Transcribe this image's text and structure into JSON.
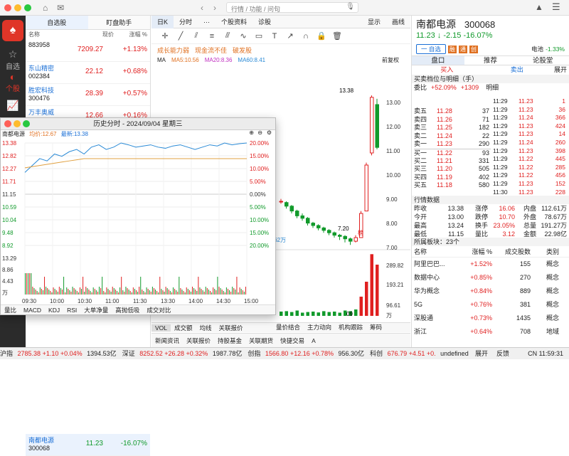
{
  "search_placeholder": "行情 / 功能 / 问句",
  "watchlist": {
    "tabs": [
      "自选股",
      "盯盘助手"
    ],
    "headers": [
      "名称",
      "现价",
      "涨幅 %"
    ],
    "rows": [
      {
        "name": "",
        "code": "883958",
        "price": "7209.27",
        "pct": "+1.13%"
      },
      {
        "name": "东山精密",
        "code": "002384",
        "price": "22.12",
        "pct": "+0.68%"
      },
      {
        "name": "胜宏科技",
        "code": "300476",
        "price": "28.39",
        "pct": "+0.57%"
      },
      {
        "name": "万丰奥威",
        "code": "",
        "price": "12.66",
        "pct": "+0.16%"
      }
    ],
    "bottom": {
      "name": "南都电源",
      "code": "300068",
      "price": "11.23",
      "pct": "-16.07%"
    }
  },
  "side": [
    "自选",
    "个股"
  ],
  "mid": {
    "tabs": [
      "日K",
      "分时",
      "···",
      "个股资料",
      "诊股"
    ],
    "right_tabs": [
      "显示",
      "画线"
    ],
    "tags": [
      "成长能力弱",
      "现金流不佳",
      "破发股"
    ],
    "ma": {
      "label": "MA",
      "ma5": "MA5:10.56",
      "ma20": "MA20:8.36",
      "ma60": "MA60:8.41"
    },
    "fq": "前复权",
    "high_label": "13.38",
    "low_label": "7.20",
    "yaxis": [
      "13.00",
      "12.00",
      "11.00",
      "10.00",
      "9.00",
      "8.00",
      "7.00"
    ],
    "vol_axis": [
      "289.82",
      "193.21",
      "96.61",
      "万"
    ],
    "vol_label": ".62万",
    "x_label": "09",
    "badge": "榜",
    "bottom_tabs": [
      "VOL",
      "成交额",
      "均线",
      "关联报价"
    ],
    "tab_row": [
      "量价结合",
      "主力动向",
      "机构跟踪",
      "筹码"
    ],
    "news": [
      "新闻资讯",
      "关联报价",
      "持股基金",
      "关联期货",
      "快捷交易",
      "A"
    ]
  },
  "popup": {
    "title": "历史分时 - 2024/09/04 星期三",
    "stock": "南都电源",
    "avg": "均价:12.67",
    "last": "最新:13.38",
    "prices": [
      "13.38",
      "12.82",
      "12.27",
      "11.71",
      "11.15",
      "10.59",
      "10.04",
      "9.48",
      "8.92"
    ],
    "pcts": [
      "20.00%",
      "15.00%",
      "10.00%",
      "5.00%",
      "0.00%",
      "5.00%",
      "10.00%",
      "15.00%",
      "20.00%"
    ],
    "vols": [
      "13.29",
      "8.86",
      "4.43",
      "万"
    ],
    "times": [
      "09:30",
      "10:00",
      "10:30",
      "11:00",
      "11:30",
      "13:30",
      "14:00",
      "14:30",
      "15:00"
    ],
    "tabs": [
      "量比",
      "MACD",
      "KDJ",
      "RSI",
      "大单净量",
      "高抛低吸",
      "成交对比"
    ]
  },
  "right": {
    "name": "南都电源",
    "code": "300068",
    "price": "11.23",
    "change": "↓ -2.15",
    "pct": "-16.07%",
    "battery_label": "电池",
    "battery_pct": "-1.33%",
    "btn_add": "一 自选",
    "badges": [
      "融",
      "通",
      "创"
    ],
    "tabs": [
      "盘口",
      "推荐",
      "论股堂"
    ],
    "trade": [
      "买入",
      "卖出",
      "展开"
    ],
    "ob_title": "买卖档位与明细（手）",
    "webi": "委比",
    "webi_val": "+52.09%",
    "webi_diff": "+1309",
    "mingxi": "明细",
    "asks": [
      [
        "卖五",
        "11.28",
        "37"
      ],
      [
        "卖四",
        "11.26",
        "71"
      ],
      [
        "卖三",
        "11.25",
        "182"
      ],
      [
        "卖二",
        "11.24",
        "22"
      ],
      [
        "卖一",
        "11.23",
        "290"
      ]
    ],
    "bids": [
      [
        "买一",
        "11.22",
        "93"
      ],
      [
        "买二",
        "11.21",
        "331"
      ],
      [
        "买三",
        "11.20",
        "505"
      ],
      [
        "买四",
        "11.19",
        "402"
      ],
      [
        "买五",
        "11.18",
        "580"
      ]
    ],
    "ticks": [
      [
        "11:29",
        "11.23",
        "36"
      ],
      [
        "11:29",
        "11.24",
        "366"
      ],
      [
        "11:29",
        "11.23",
        "424"
      ],
      [
        "11:29",
        "11.23",
        "14"
      ],
      [
        "11:29",
        "11.24",
        "260"
      ],
      [
        "11:29",
        "11.23",
        "398"
      ],
      [
        "11:29",
        "11.22",
        "445"
      ],
      [
        "11:29",
        "11.22",
        "285"
      ],
      [
        "11:29",
        "11.22",
        "456"
      ],
      [
        "11:29",
        "11.23",
        "152"
      ],
      [
        "11:30",
        "11.23",
        "228"
      ]
    ],
    "tick_head": [
      "11:29",
      "11.23",
      "1"
    ],
    "stats_title": "行情数据",
    "stats": [
      [
        "昨收",
        "13.38",
        "涨停",
        "16.06",
        "内盘",
        "112.61万"
      ],
      [
        "今开",
        "13.00",
        "跌停",
        "10.70",
        "外盘",
        "78.67万"
      ],
      [
        "最高",
        "13.24",
        "换手",
        "23.05%",
        "总量",
        "191.27万"
      ],
      [
        "最低",
        "11.15",
        "量比",
        "3.12",
        "金额",
        "22.98亿"
      ]
    ],
    "sector_title": "所属板块：23个",
    "sector_head": [
      "名称",
      "涨幅 %",
      "成交股数",
      "类别"
    ],
    "sectors": [
      [
        "阿里巴巴...",
        "+1.52%",
        "155",
        "概念"
      ],
      [
        "数据中心",
        "+0.85%",
        "270",
        "概念"
      ],
      [
        "华为概念",
        "+0.84%",
        "889",
        "概念"
      ],
      [
        "5G",
        "+0.76%",
        "381",
        "概念"
      ],
      [
        "深股通",
        "+0.73%",
        "1435",
        "概念"
      ],
      [
        "浙江",
        "+0.64%",
        "708",
        "地域"
      ]
    ]
  },
  "status": {
    "items": [
      [
        "沪指",
        "2785.38",
        "+1.10",
        "+0.04%",
        "1394.53亿"
      ],
      [
        "深证",
        "8252.52",
        "+26.28",
        "+0.32%",
        "1987.78亿"
      ],
      [
        "创指",
        "1566.80",
        "+12.16",
        "+0.78%",
        "956.30亿"
      ],
      [
        "科创",
        "676.79",
        "+4.51",
        "+0."
      ]
    ],
    "right": [
      "展开",
      "反馈",
      "CN 11:59:31"
    ]
  }
}
